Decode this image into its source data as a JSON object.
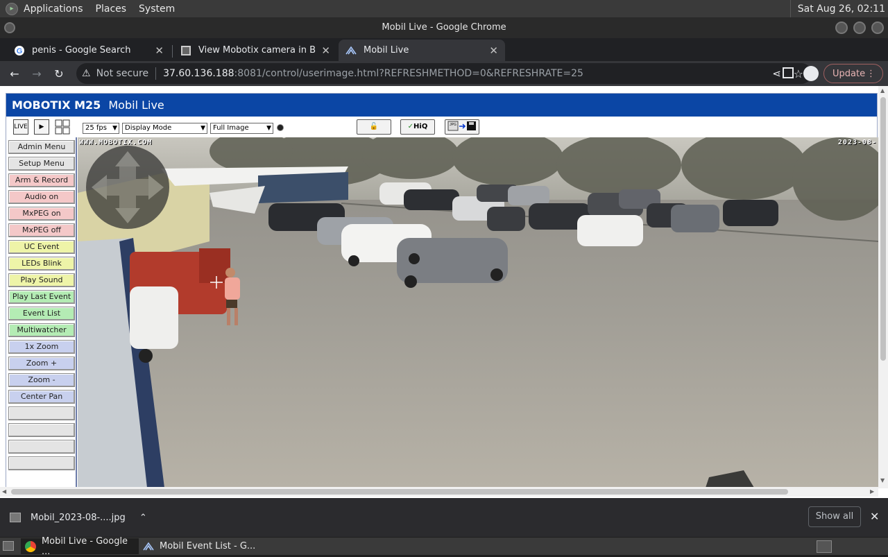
{
  "panel": {
    "menus": [
      "Applications",
      "Places",
      "System"
    ],
    "clock": "Sat Aug 26, 02:11"
  },
  "window": {
    "title": "Mobil Live - Google Chrome"
  },
  "tabs": [
    {
      "title": "penis - Google Search",
      "icon": "google-icon"
    },
    {
      "title": "View Mobotix camera in Bulga",
      "icon": "camera-page-icon"
    },
    {
      "title": "Mobil Live",
      "icon": "mobotix-icon"
    }
  ],
  "toolbar": {
    "security": "Not secure",
    "url_host": "37.60.136.188",
    "url_path": ":8081/control/userimage.html?REFRESHMETHOD=0&REFRESHRATE=25",
    "update_label": "Update"
  },
  "camera": {
    "model": "MOBOTIX M25",
    "title": "Mobil Live",
    "fps": "25 fps",
    "display_mode": "Display Mode",
    "image_mode": "Full Image",
    "hiq_label": "HiQ",
    "live_label": "LIVE",
    "overlay_left": "WWW.MOBOTIX.COM",
    "overlay_right": "2023-08-"
  },
  "menu_buttons": [
    {
      "label": "Admin Menu",
      "color": "#e4e4e4"
    },
    {
      "label": "Setup Menu",
      "color": "#e4e4e4"
    },
    {
      "label": "Arm & Record",
      "color": "#f4c8c8"
    },
    {
      "label": "Audio on",
      "color": "#f4c8c8"
    },
    {
      "label": "MxPEG on",
      "color": "#f4c8c8"
    },
    {
      "label": "MxPEG off",
      "color": "#f4c8c8"
    },
    {
      "label": "UC Event",
      "color": "#eef4a8"
    },
    {
      "label": "LEDs Blink",
      "color": "#eef4a8"
    },
    {
      "label": "Play Sound",
      "color": "#eef4a8"
    },
    {
      "label": "Play Last Event",
      "color": "#b4ecb4"
    },
    {
      "label": "Event List",
      "color": "#b4ecb4"
    },
    {
      "label": "Multiwatcher",
      "color": "#b4ecb4"
    },
    {
      "label": "1x Zoom",
      "color": "#c8d0ee"
    },
    {
      "label": "Zoom +",
      "color": "#c8d0ee"
    },
    {
      "label": "Zoom -",
      "color": "#c8d0ee"
    },
    {
      "label": "Center Pan",
      "color": "#c8d0ee"
    },
    {
      "label": "",
      "color": "#e4e4e4"
    },
    {
      "label": "",
      "color": "#e4e4e4"
    },
    {
      "label": "",
      "color": "#e4e4e4"
    },
    {
      "label": "",
      "color": "#e4e4e4"
    }
  ],
  "download": {
    "filename": "Mobil_2023-08-....jpg",
    "show_all": "Show all"
  },
  "taskbar": [
    {
      "label": "Mobil Live - Google ...",
      "icon": "chrome-icon"
    },
    {
      "label": "Mobil Event List - G...",
      "icon": "mobotix-icon"
    }
  ]
}
